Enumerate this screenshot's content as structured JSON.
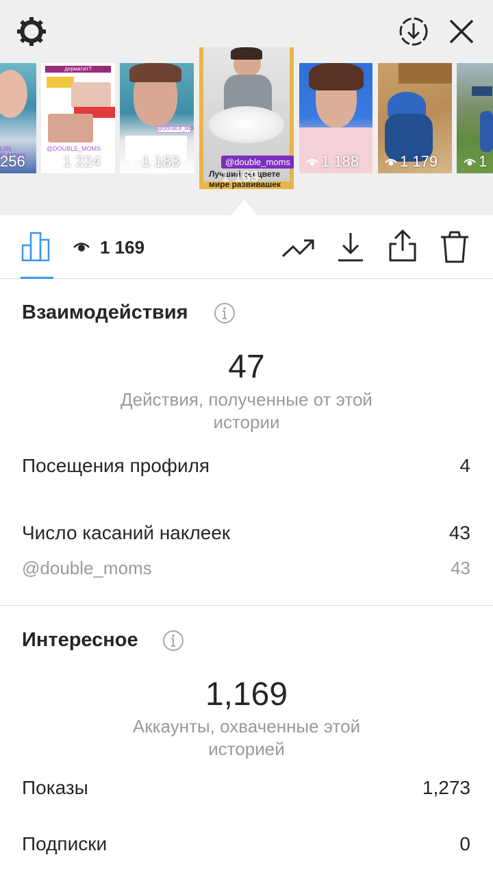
{
  "story_strip": {
    "thumbnails": [
      {
        "views": "256",
        "caption": "",
        "tag": "LIIN F_MOMS"
      },
      {
        "views": "1 224",
        "caption": "дерматит?",
        "tag": "@DOUBLE_MOMS"
      },
      {
        "views": "1 183",
        "caption": "",
        "tag": "@DOUBLE_MOMS"
      },
      {
        "views": "1 188",
        "caption": "",
        "tag": ""
      },
      {
        "views": "1 179",
        "caption": "",
        "tag": ""
      },
      {
        "views": "1",
        "caption": "",
        "tag": ""
      }
    ],
    "selected": {
      "views": "1 169",
      "tag": "@double_moms",
      "caption": "Лучший сы цвете мире развивашек"
    }
  },
  "toolbar": {
    "views": "1 169",
    "accent_color": "#3897f0"
  },
  "interactions": {
    "title": "Взаимодействия",
    "total": "47",
    "total_label": "Действия, полученные от этой истории",
    "rows": [
      {
        "label": "Посещения профиля",
        "value": "4"
      },
      {
        "label": "Число касаний наклеек",
        "value": "43"
      }
    ],
    "sub_row": {
      "label": "@double_moms",
      "value": "43"
    }
  },
  "discovery": {
    "title": "Интересное",
    "total": "1,169",
    "total_label": "Аккаунты, охваченные этой историей",
    "rows": [
      {
        "label": "Показы",
        "value": "1,273"
      },
      {
        "label": "Подписки",
        "value": "0"
      }
    ]
  }
}
